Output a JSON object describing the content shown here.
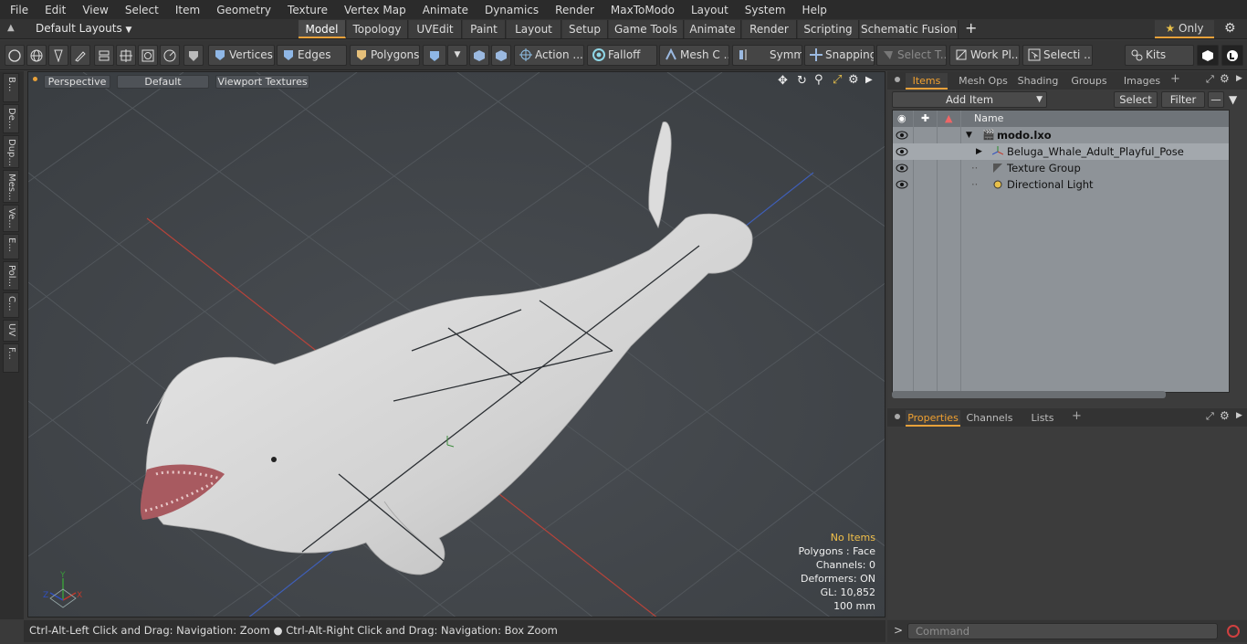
{
  "menu": [
    "File",
    "Edit",
    "View",
    "Select",
    "Item",
    "Geometry",
    "Texture",
    "Vertex Map",
    "Animate",
    "Dynamics",
    "Render",
    "MaxToModo",
    "Layout",
    "System",
    "Help"
  ],
  "layouts": {
    "dropdown": "Default Layouts",
    "tabs": [
      "Model",
      "Topology",
      "UVEdit",
      "Paint",
      "Layout",
      "Setup",
      "Game Tools",
      "Animate",
      "Render",
      "Scripting",
      "Schematic Fusion"
    ],
    "active_tab": "Model",
    "plus": "+",
    "only_label": "Only",
    "star": "★"
  },
  "toolbar": {
    "vertices": "Vertices",
    "edges": "Edges",
    "polygons": "Polygons",
    "action": "Action ...",
    "falloff": "Falloff",
    "mesh": "Mesh C ...",
    "symm": "Symm ...",
    "snapping": "Snapping",
    "select_t": "Select T...",
    "work_pl": "Work Pl...",
    "selecti": "Selecti ...",
    "kits": "Kits"
  },
  "left_tabs": [
    "B...",
    "De...",
    "Dup...",
    "Mes...",
    "Ve...",
    "E...",
    "Pol...",
    "C...",
    "UV",
    "F..."
  ],
  "viewport": {
    "view": "Perspective",
    "shading": "Default",
    "textures": "Viewport Textures",
    "info": {
      "no_items": "No Items",
      "polygons": "Polygons : Face",
      "channels": "Channels: 0",
      "deformers": "Deformers: ON",
      "gl": "GL: 10,852",
      "scale": "100 mm"
    },
    "axis_x": "X",
    "axis_y": "Y",
    "axis_z": "Z"
  },
  "status": "Ctrl-Alt-Left Click and Drag: Navigation: Zoom ● Ctrl-Alt-Right Click and Drag: Navigation: Box Zoom",
  "items_panel": {
    "tabs": [
      "Items",
      "Mesh Ops",
      "Shading",
      "Groups",
      "Images"
    ],
    "active": "Items",
    "add_item": "Add Item",
    "select": "Select",
    "filter": "Filter",
    "name_header": "Name",
    "rows": [
      {
        "label": "modo.lxo",
        "bold": true
      },
      {
        "label": "Beluga_Whale_Adult_Playful_Pose",
        "bold": false
      },
      {
        "label": "Texture Group",
        "bold": false
      },
      {
        "label": "Directional Light",
        "bold": false
      }
    ]
  },
  "properties_panel": {
    "tabs": [
      "Properties",
      "Channels",
      "Lists"
    ],
    "active": "Properties"
  },
  "command": {
    "arrow": ">",
    "placeholder": "Command"
  },
  "colors": {
    "accent": "#e8a13a",
    "viewport_bg": "#414549",
    "grid_red": "#c0392b",
    "grid_blue": "#3050c0",
    "whale": "#d9d9d9"
  }
}
